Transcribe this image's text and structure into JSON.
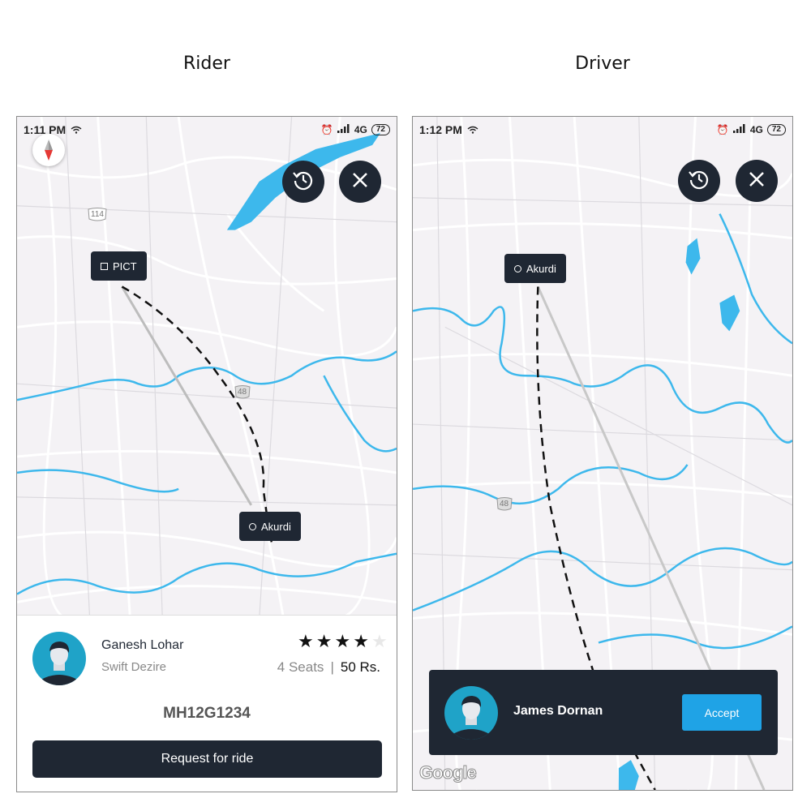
{
  "headings": {
    "rider": "Rider",
    "driver": "Driver"
  },
  "rider": {
    "status_time": "1:11 PM",
    "network": "4G",
    "battery": "72",
    "pickup_label": "PICT",
    "drop_label": "Akurdi",
    "shield_114": "114",
    "shield_48": "48",
    "driver_name": "Ganesh Lohar",
    "car": "Swift Dezire",
    "rating": 4,
    "rating_max": 5,
    "seats": "4 Seats",
    "separator": "|",
    "price": "50 Rs.",
    "plate": "MH12G1234",
    "request_label": "Request for ride"
  },
  "driver": {
    "status_time": "1:12 PM",
    "network": "4G",
    "battery": "72",
    "location_label": "Akurdi",
    "shield_48": "48",
    "rider_name": "James Dornan",
    "accept_label": "Accept",
    "map_attribution": "Google"
  },
  "colors": {
    "dark": "#1f2733",
    "accent": "#1fa3e6",
    "water": "#3db8ec",
    "map_bg": "#f4f2f5"
  },
  "icons": [
    "wifi-icon",
    "signal-icon",
    "alarm-icon",
    "compass-icon",
    "history-icon",
    "close-icon",
    "star-icon",
    "avatar-icon"
  ]
}
